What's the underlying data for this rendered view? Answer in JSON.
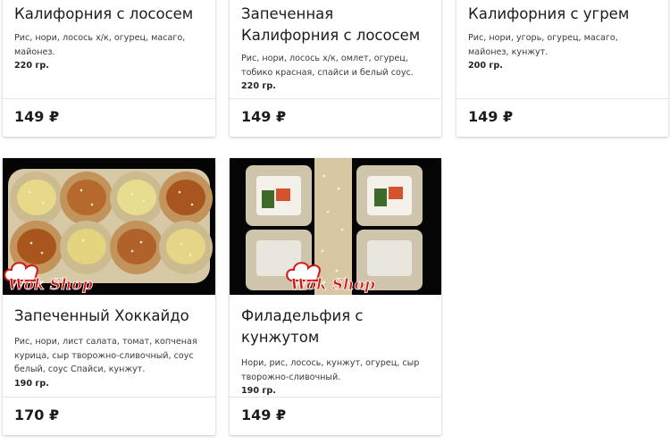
{
  "products": [
    {
      "title": "Калифорния с лососем",
      "description": "Рис, нори, лосось х/к, огурец,  масаго, майонез.",
      "weight": "220 гр.",
      "price": "149 ₽"
    },
    {
      "title": "Запеченная Калифорния с лососем",
      "description": "Рис, нори, лосось х/к, омлет, огурец, тобико красная, спайси и белый соус.",
      "weight": "220 гр.",
      "price": "149 ₽"
    },
    {
      "title": "Калифорния с угрем",
      "description": "Рис, нори, угорь, огурец, масаго, майонез, кунжут.",
      "weight": "200 гр.",
      "price": "149 ₽"
    },
    {
      "title": "Запеченный Хоккайдо",
      "description": "Рис, нори, лист салата, томат, копченая курица, сыр творожно-сливочный, соус белый, соус Спайси, кунжут.",
      "weight": "190 гр.",
      "price": "170 ₽",
      "image_logo": "Wok Shop"
    },
    {
      "title": "Филадельфия с кунжутом",
      "description": "Нори, рис, лосось, кунжут, огурец, сыр творожно-сливочный.",
      "weight": "190 гр.",
      "price": "149 ₽",
      "image_logo": "Wok Shop"
    }
  ]
}
